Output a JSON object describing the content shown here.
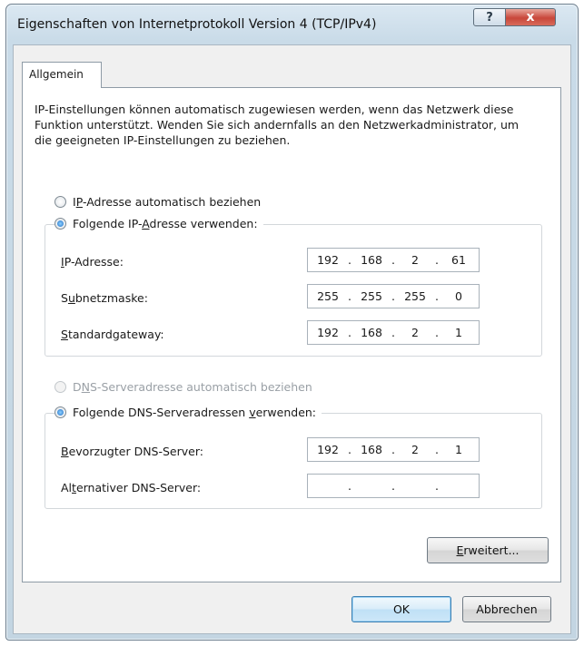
{
  "window": {
    "title": "Eigenschaften von Internetprotokoll Version 4 (TCP/IPv4)",
    "help_label": "?",
    "close_label": "x"
  },
  "tabs": [
    {
      "label": "Allgemein"
    }
  ],
  "description": "IP-Einstellungen können automatisch zugewiesen werden, wenn das Netzwerk diese Funktion unterstützt. Wenden Sie sich andernfalls an den Netzwerkadministrator, um die geeigneten IP-Einstellungen zu beziehen.",
  "ip": {
    "auto_option": {
      "pre": "I",
      "acc": "P",
      "post": "-Adresse automatisch beziehen",
      "selected": false,
      "enabled": true
    },
    "manual_option": {
      "pre": "Folgende IP-",
      "acc": "A",
      "post": "dresse verwenden:",
      "selected": true,
      "enabled": true
    },
    "fields": [
      {
        "pre": "",
        "acc": "I",
        "post": "P-Adresse:",
        "octets": [
          "192",
          "168",
          "2",
          "61"
        ]
      },
      {
        "pre": "S",
        "acc": "u",
        "post": "bnetzmaske:",
        "octets": [
          "255",
          "255",
          "255",
          "0"
        ]
      },
      {
        "pre": "",
        "acc": "S",
        "post": "tandardgateway:",
        "octets": [
          "192",
          "168",
          "2",
          "1"
        ]
      }
    ]
  },
  "dns": {
    "auto_option": {
      "pre": "D",
      "acc": "N",
      "post": "S-Serveradresse automatisch beziehen",
      "selected": false,
      "enabled": false
    },
    "manual_option": {
      "pre": "Folgende DNS-Serveradressen ",
      "acc": "v",
      "post": "erwenden:",
      "selected": true,
      "enabled": true
    },
    "fields": [
      {
        "pre": "",
        "acc": "B",
        "post": "evorzugter DNS-Server:",
        "octets": [
          "192",
          "168",
          "2",
          "1"
        ]
      },
      {
        "pre": "Al",
        "acc": "t",
        "post": "ernativer DNS-Server:",
        "octets": [
          "",
          "",
          "",
          ""
        ]
      }
    ]
  },
  "buttons": {
    "advanced": {
      "acc": "E",
      "post": "rweitert..."
    },
    "ok": "OK",
    "cancel": "Abbrechen"
  }
}
